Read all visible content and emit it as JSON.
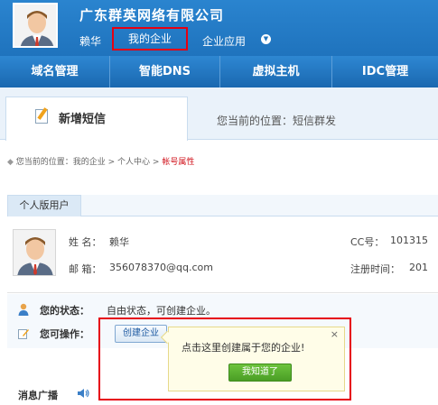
{
  "header": {
    "company": "广东群英网络有限公司",
    "user": "赖华",
    "enterprise": "我的企业",
    "apps": "企业应用"
  },
  "nav": {
    "items": [
      "域名管理",
      "智能DNS",
      "虚拟主机",
      "IDC管理"
    ]
  },
  "tabbar": {
    "active_tab": "新增短信",
    "location": "您当前的位置：短信群发"
  },
  "breadcrumb": {
    "prefix": "您当前的位置：我的企业 > 个人中心 > ",
    "current": "帐号属性"
  },
  "section": {
    "tab": "个人版用户"
  },
  "profile": {
    "name_label": "姓  名：",
    "name_value": "赖华",
    "email_label": "邮  箱：",
    "email_value": "356078370@qq.com",
    "cc_label": "CC号：",
    "cc_value": "101315",
    "reg_label": "注册时间：",
    "reg_value": "201"
  },
  "status": {
    "label": "您的状态：",
    "value": "自由状态，可创建企业。",
    "ops_label": "您可操作：",
    "create_btn": "创建企业"
  },
  "popup": {
    "text": "点击这里创建属于您的企业!",
    "ok": "我知道了",
    "close": "×"
  },
  "broadcast": {
    "label": "消息广播"
  },
  "colors": {
    "header_blue": "#1f73bd",
    "highlight_red": "#e60012",
    "breadcrumb_current": "#d0121b",
    "ok_green": "#4a9e25"
  }
}
